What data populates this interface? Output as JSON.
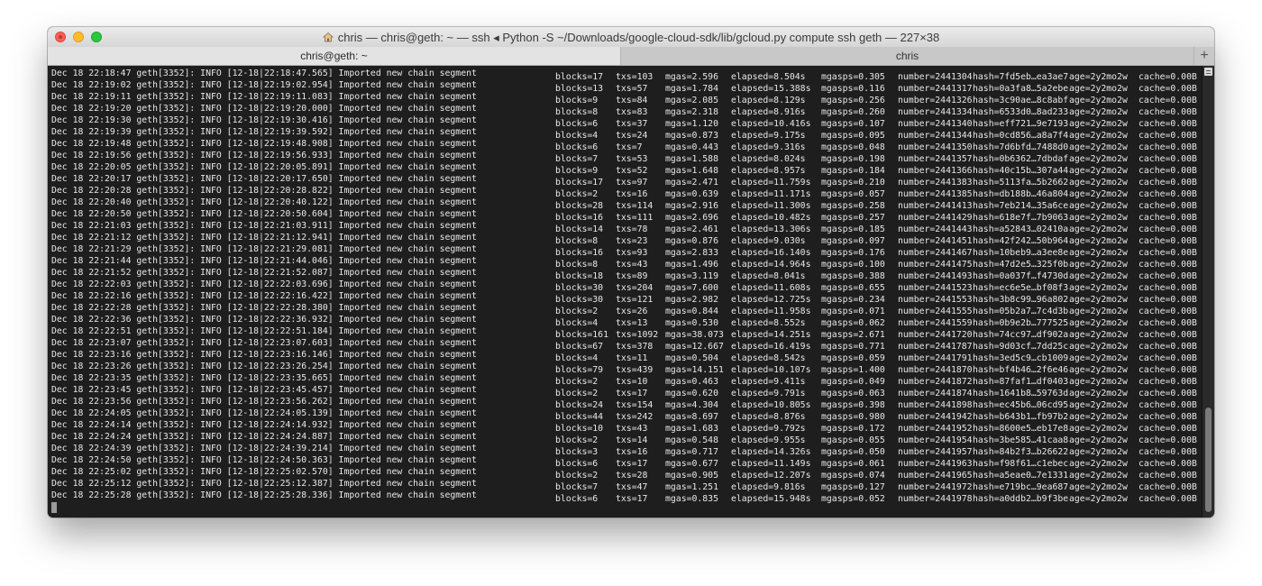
{
  "window": {
    "title": "chris — chris@geth: ~ — ssh ◂ Python -S ~/Downloads/google-cloud-sdk/lib/gcloud.py compute ssh geth — 227×38",
    "tabs": [
      "chris@geth: ~",
      "chris"
    ],
    "add_tab_label": "+"
  },
  "terminal": {
    "prefix": "geth[3352]: INFO",
    "message": "Imported new chain segment",
    "age": "age=2y2mo2w",
    "cache": "cache=0.00B",
    "lines": [
      {
        "ts": "Dec 18 22:18:47",
        "ts2": "[12-18|22:18:47.565]",
        "blocks": "blocks=17",
        "txs": "txs=103",
        "mgas": "mgas=2.596",
        "elapsed": "elapsed=8.504s",
        "mgasps": "mgasps=0.305",
        "number": "number=2441304",
        "hash": "hash=7fd5eb…ea3ae7"
      },
      {
        "ts": "Dec 18 22:19:02",
        "ts2": "[12-18|22:19:02.954]",
        "blocks": "blocks=13",
        "txs": "txs=57",
        "mgas": "mgas=1.784",
        "elapsed": "elapsed=15.388s",
        "mgasps": "mgasps=0.116",
        "number": "number=2441317",
        "hash": "hash=0a3fa8…5a2ebe"
      },
      {
        "ts": "Dec 18 22:19:11",
        "ts2": "[12-18|22:19:11.083]",
        "blocks": "blocks=9",
        "txs": "txs=84",
        "mgas": "mgas=2.085",
        "elapsed": "elapsed=8.129s",
        "mgasps": "mgasps=0.256",
        "number": "number=2441326",
        "hash": "hash=3c90ae…8c8abf"
      },
      {
        "ts": "Dec 18 22:19:20",
        "ts2": "[12-18|22:19:20.000]",
        "blocks": "blocks=8",
        "txs": "txs=83",
        "mgas": "mgas=2.318",
        "elapsed": "elapsed=8.916s",
        "mgasps": "mgasps=0.260",
        "number": "number=2441334",
        "hash": "hash=6533d0…8ad233"
      },
      {
        "ts": "Dec 18 22:19:30",
        "ts2": "[12-18|22:19:30.416]",
        "blocks": "blocks=6",
        "txs": "txs=37",
        "mgas": "mgas=1.120",
        "elapsed": "elapsed=10.416s",
        "mgasps": "mgasps=0.107",
        "number": "number=2441340",
        "hash": "hash=eff721…9e7193"
      },
      {
        "ts": "Dec 18 22:19:39",
        "ts2": "[12-18|22:19:39.592]",
        "blocks": "blocks=4",
        "txs": "txs=24",
        "mgas": "mgas=0.873",
        "elapsed": "elapsed=9.175s",
        "mgasps": "mgasps=0.095",
        "number": "number=2441344",
        "hash": "hash=0cd856…a8a7f4"
      },
      {
        "ts": "Dec 18 22:19:48",
        "ts2": "[12-18|22:19:48.908]",
        "blocks": "blocks=6",
        "txs": "txs=7",
        "mgas": "mgas=0.443",
        "elapsed": "elapsed=9.316s",
        "mgasps": "mgasps=0.048",
        "number": "number=2441350",
        "hash": "hash=7d6bfd…7488d0"
      },
      {
        "ts": "Dec 18 22:19:56",
        "ts2": "[12-18|22:19:56.933]",
        "blocks": "blocks=7",
        "txs": "txs=53",
        "mgas": "mgas=1.588",
        "elapsed": "elapsed=8.024s",
        "mgasps": "mgasps=0.198",
        "number": "number=2441357",
        "hash": "hash=0b6362…7dbdaf"
      },
      {
        "ts": "Dec 18 22:20:05",
        "ts2": "[12-18|22:20:05.891]",
        "blocks": "blocks=9",
        "txs": "txs=52",
        "mgas": "mgas=1.648",
        "elapsed": "elapsed=8.957s",
        "mgasps": "mgasps=0.184",
        "number": "number=2441366",
        "hash": "hash=40c15b…307a44"
      },
      {
        "ts": "Dec 18 22:20:17",
        "ts2": "[12-18|22:20:17.650]",
        "blocks": "blocks=17",
        "txs": "txs=97",
        "mgas": "mgas=2.471",
        "elapsed": "elapsed=11.759s",
        "mgasps": "mgasps=0.210",
        "number": "number=2441383",
        "hash": "hash=5113fa…5b2662"
      },
      {
        "ts": "Dec 18 22:20:28",
        "ts2": "[12-18|22:20:28.822]",
        "blocks": "blocks=2",
        "txs": "txs=16",
        "mgas": "mgas=0.639",
        "elapsed": "elapsed=11.171s",
        "mgasps": "mgasps=0.057",
        "number": "number=2441385",
        "hash": "hash=db188b…46a804"
      },
      {
        "ts": "Dec 18 22:20:40",
        "ts2": "[12-18|22:20:40.122]",
        "blocks": "blocks=28",
        "txs": "txs=114",
        "mgas": "mgas=2.916",
        "elapsed": "elapsed=11.300s",
        "mgasps": "mgasps=0.258",
        "number": "number=2441413",
        "hash": "hash=7eb214…35a6ce"
      },
      {
        "ts": "Dec 18 22:20:50",
        "ts2": "[12-18|22:20:50.604]",
        "blocks": "blocks=16",
        "txs": "txs=111",
        "mgas": "mgas=2.696",
        "elapsed": "elapsed=10.482s",
        "mgasps": "mgasps=0.257",
        "number": "number=2441429",
        "hash": "hash=618e7f…7b9063"
      },
      {
        "ts": "Dec 18 22:21:03",
        "ts2": "[12-18|22:21:03.911]",
        "blocks": "blocks=14",
        "txs": "txs=78",
        "mgas": "mgas=2.461",
        "elapsed": "elapsed=13.306s",
        "mgasps": "mgasps=0.185",
        "number": "number=2441443",
        "hash": "hash=a52843…02410a"
      },
      {
        "ts": "Dec 18 22:21:12",
        "ts2": "[12-18|22:21:12.941]",
        "blocks": "blocks=8",
        "txs": "txs=23",
        "mgas": "mgas=0.876",
        "elapsed": "elapsed=9.030s",
        "mgasps": "mgasps=0.097",
        "number": "number=2441451",
        "hash": "hash=42f242…50b964"
      },
      {
        "ts": "Dec 18 22:21:29",
        "ts2": "[12-18|22:21:29.081]",
        "blocks": "blocks=16",
        "txs": "txs=93",
        "mgas": "mgas=2.833",
        "elapsed": "elapsed=16.140s",
        "mgasps": "mgasps=0.176",
        "number": "number=2441467",
        "hash": "hash=10beb9…a3ee8e"
      },
      {
        "ts": "Dec 18 22:21:44",
        "ts2": "[12-18|22:21:44.046]",
        "blocks": "blocks=8",
        "txs": "txs=43",
        "mgas": "mgas=1.496",
        "elapsed": "elapsed=14.964s",
        "mgasps": "mgasps=0.100",
        "number": "number=2441475",
        "hash": "hash=47d2e5…325f0b"
      },
      {
        "ts": "Dec 18 22:21:52",
        "ts2": "[12-18|22:21:52.087]",
        "blocks": "blocks=18",
        "txs": "txs=89",
        "mgas": "mgas=3.119",
        "elapsed": "elapsed=8.041s",
        "mgasps": "mgasps=0.388",
        "number": "number=2441493",
        "hash": "hash=0a037f…f4730d"
      },
      {
        "ts": "Dec 18 22:22:03",
        "ts2": "[12-18|22:22:03.696]",
        "blocks": "blocks=30",
        "txs": "txs=204",
        "mgas": "mgas=7.600",
        "elapsed": "elapsed=11.608s",
        "mgasps": "mgasps=0.655",
        "number": "number=2441523",
        "hash": "hash=ec6e5e…bf08f3"
      },
      {
        "ts": "Dec 18 22:22:16",
        "ts2": "[12-18|22:22:16.422]",
        "blocks": "blocks=30",
        "txs": "txs=121",
        "mgas": "mgas=2.982",
        "elapsed": "elapsed=12.725s",
        "mgasps": "mgasps=0.234",
        "number": "number=2441553",
        "hash": "hash=3b8c99…96a802"
      },
      {
        "ts": "Dec 18 22:22:28",
        "ts2": "[12-18|22:22:28.380]",
        "blocks": "blocks=2",
        "txs": "txs=26",
        "mgas": "mgas=0.844",
        "elapsed": "elapsed=11.958s",
        "mgasps": "mgasps=0.071",
        "number": "number=2441555",
        "hash": "hash=05b2a7…7c4d3b"
      },
      {
        "ts": "Dec 18 22:22:36",
        "ts2": "[12-18|22:22:36.932]",
        "blocks": "blocks=4",
        "txs": "txs=13",
        "mgas": "mgas=0.530",
        "elapsed": "elapsed=8.552s",
        "mgasps": "mgasps=0.062",
        "number": "number=2441559",
        "hash": "hash=0b9e2b…777525"
      },
      {
        "ts": "Dec 18 22:22:51",
        "ts2": "[12-18|22:22:51.184]",
        "blocks": "blocks=161",
        "txs": "txs=1092",
        "mgas": "mgas=38.073",
        "elapsed": "elapsed=14.251s",
        "mgasps": "mgasps=2.671",
        "number": "number=2441720",
        "hash": "hash=74cc97…df902a"
      },
      {
        "ts": "Dec 18 22:23:07",
        "ts2": "[12-18|22:23:07.603]",
        "blocks": "blocks=67",
        "txs": "txs=378",
        "mgas": "mgas=12.667",
        "elapsed": "elapsed=16.419s",
        "mgasps": "mgasps=0.771",
        "number": "number=2441787",
        "hash": "hash=9d03cf…7dd25c"
      },
      {
        "ts": "Dec 18 22:23:16",
        "ts2": "[12-18|22:23:16.146]",
        "blocks": "blocks=4",
        "txs": "txs=11",
        "mgas": "mgas=0.504",
        "elapsed": "elapsed=8.542s",
        "mgasps": "mgasps=0.059",
        "number": "number=2441791",
        "hash": "hash=3ed5c9…cb1009"
      },
      {
        "ts": "Dec 18 22:23:26",
        "ts2": "[12-18|22:23:26.254]",
        "blocks": "blocks=79",
        "txs": "txs=439",
        "mgas": "mgas=14.151",
        "elapsed": "elapsed=10.107s",
        "mgasps": "mgasps=1.400",
        "number": "number=2441870",
        "hash": "hash=bf4b46…2f6e46"
      },
      {
        "ts": "Dec 18 22:23:35",
        "ts2": "[12-18|22:23:35.665]",
        "blocks": "blocks=2",
        "txs": "txs=10",
        "mgas": "mgas=0.463",
        "elapsed": "elapsed=9.411s",
        "mgasps": "mgasps=0.049",
        "number": "number=2441872",
        "hash": "hash=87faf1…df0403"
      },
      {
        "ts": "Dec 18 22:23:45",
        "ts2": "[12-18|22:23:45.457]",
        "blocks": "blocks=2",
        "txs": "txs=17",
        "mgas": "mgas=0.620",
        "elapsed": "elapsed=9.791s",
        "mgasps": "mgasps=0.063",
        "number": "number=2441874",
        "hash": "hash=1641b8…59763d"
      },
      {
        "ts": "Dec 18 22:23:56",
        "ts2": "[12-18|22:23:56.262]",
        "blocks": "blocks=24",
        "txs": "txs=154",
        "mgas": "mgas=4.304",
        "elapsed": "elapsed=10.805s",
        "mgasps": "mgasps=0.398",
        "number": "number=2441898",
        "hash": "hash=ec45b6…06cd95"
      },
      {
        "ts": "Dec 18 22:24:05",
        "ts2": "[12-18|22:24:05.139]",
        "blocks": "blocks=44",
        "txs": "txs=242",
        "mgas": "mgas=8.697",
        "elapsed": "elapsed=8.876s",
        "mgasps": "mgasps=0.980",
        "number": "number=2441942",
        "hash": "hash=b643b1…fb97b2"
      },
      {
        "ts": "Dec 18 22:24:14",
        "ts2": "[12-18|22:24:14.932]",
        "blocks": "blocks=10",
        "txs": "txs=43",
        "mgas": "mgas=1.683",
        "elapsed": "elapsed=9.792s",
        "mgasps": "mgasps=0.172",
        "number": "number=2441952",
        "hash": "hash=8600e5…eb17e8"
      },
      {
        "ts": "Dec 18 22:24:24",
        "ts2": "[12-18|22:24:24.887]",
        "blocks": "blocks=2",
        "txs": "txs=14",
        "mgas": "mgas=0.548",
        "elapsed": "elapsed=9.955s",
        "mgasps": "mgasps=0.055",
        "number": "number=2441954",
        "hash": "hash=3be585…41caa8"
      },
      {
        "ts": "Dec 18 22:24:39",
        "ts2": "[12-18|22:24:39.214]",
        "blocks": "blocks=3",
        "txs": "txs=16",
        "mgas": "mgas=0.717",
        "elapsed": "elapsed=14.326s",
        "mgasps": "mgasps=0.050",
        "number": "number=2441957",
        "hash": "hash=84b2f3…b26622"
      },
      {
        "ts": "Dec 18 22:24:50",
        "ts2": "[12-18|22:24:50.363]",
        "blocks": "blocks=6",
        "txs": "txs=17",
        "mgas": "mgas=0.677",
        "elapsed": "elapsed=11.149s",
        "mgasps": "mgasps=0.061",
        "number": "number=2441963",
        "hash": "hash=f98f61…c1ebec"
      },
      {
        "ts": "Dec 18 22:25:02",
        "ts2": "[12-18|22:25:02.570]",
        "blocks": "blocks=2",
        "txs": "txs=28",
        "mgas": "mgas=0.905",
        "elapsed": "elapsed=12.207s",
        "mgasps": "mgasps=0.074",
        "number": "number=2441965",
        "hash": "hash=a5eae0…7e1331"
      },
      {
        "ts": "Dec 18 22:25:12",
        "ts2": "[12-18|22:25:12.387]",
        "blocks": "blocks=7",
        "txs": "txs=47",
        "mgas": "mgas=1.251",
        "elapsed": "elapsed=9.816s",
        "mgasps": "mgasps=0.127",
        "number": "number=2441972",
        "hash": "hash=e719bc…9ea687"
      },
      {
        "ts": "Dec 18 22:25:28",
        "ts2": "[12-18|22:25:28.336]",
        "blocks": "blocks=6",
        "txs": "txs=17",
        "mgas": "mgas=0.835",
        "elapsed": "elapsed=15.948s",
        "mgasps": "mgasps=0.052",
        "number": "number=2441978",
        "hash": "hash=a0ddb2…b9f3be"
      }
    ]
  },
  "colors": {
    "terminal_bg": "#1e1e1e",
    "terminal_fg": "#e8e8e8",
    "close": "#fc5f57",
    "minimize": "#fdbc2e",
    "zoom": "#29c840"
  }
}
